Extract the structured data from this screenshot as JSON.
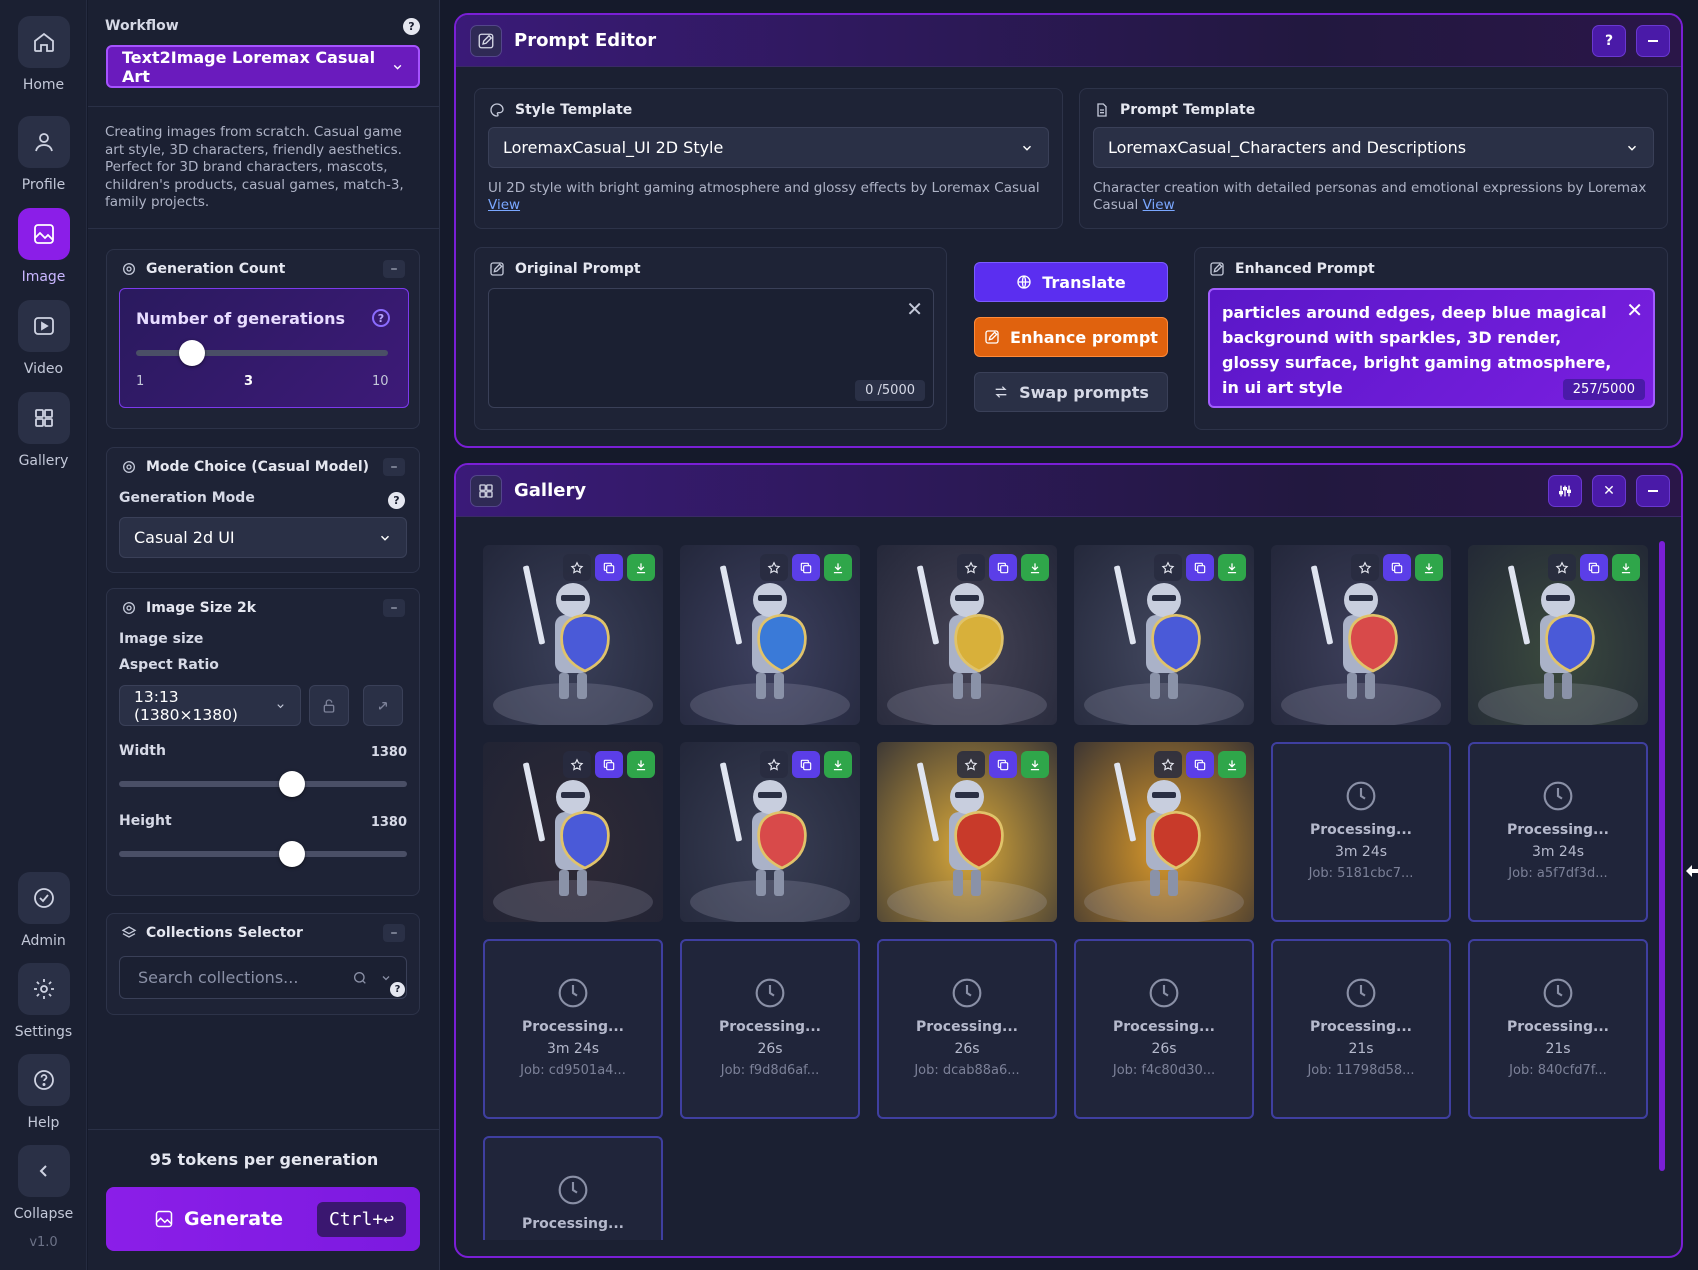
{
  "rail": {
    "items": [
      {
        "label": "Home",
        "icon": "home-icon"
      },
      {
        "label": "Profile",
        "icon": "user-icon"
      },
      {
        "label": "Image",
        "icon": "image-icon",
        "active": true
      },
      {
        "label": "Video",
        "icon": "video-icon"
      },
      {
        "label": "Gallery",
        "icon": "grid-icon"
      }
    ],
    "bottom": [
      {
        "label": "Admin",
        "icon": "shield-check-icon"
      },
      {
        "label": "Settings",
        "icon": "gear-icon"
      },
      {
        "label": "Help",
        "icon": "help-circle-icon"
      },
      {
        "label": "Collapse",
        "icon": "chevron-left-icon"
      }
    ],
    "version": "v1.0"
  },
  "panel": {
    "workflow_label": "Workflow",
    "workflow_value": "Text2Image Loremax Casual Art",
    "workflow_description": "Creating images from scratch. Casual game art style, 3D characters, friendly aesthetics. Perfect for 3D brand characters, mascots, children's products, casual games, match-3, family projects.",
    "generation_count": {
      "title": "Generation Count",
      "label": "Number of generations",
      "min": "1",
      "value": "3",
      "max": "10",
      "fraction": 0.222
    },
    "mode": {
      "title": "Mode Choice (Casual Model)",
      "label": "Generation Mode",
      "value": "Casual 2d UI"
    },
    "image_size": {
      "title": "Image Size 2k",
      "size_label": "Image size",
      "aspect_label": "Aspect Ratio",
      "aspect_value": "13:13 (1380×1380)",
      "width_label": "Width",
      "width_value": "1380",
      "width_fraction": 0.6,
      "height_label": "Height",
      "height_value": "1380",
      "height_fraction": 0.6
    },
    "collections": {
      "title": "Collections Selector",
      "placeholder": "Search collections..."
    },
    "tokens": "95 tokens per generation",
    "generate_label": "Generate",
    "shortcut": "Ctrl+↩"
  },
  "prompt_editor": {
    "title": "Prompt Editor",
    "help": "?",
    "style_template": {
      "title": "Style Template",
      "value": "LoremaxCasual_UI 2D Style",
      "description": "UI 2D style with bright gaming atmosphere and glossy effects by Loremax Casual",
      "link": "View"
    },
    "prompt_template": {
      "title": "Prompt Template",
      "value": "LoremaxCasual_Characters and Descriptions",
      "description": "Character creation with detailed personas and emotional expressions by Loremax Casual",
      "link": "View"
    },
    "original": {
      "title": "Original Prompt",
      "value": "",
      "counter": "0 /5000"
    },
    "buttons": {
      "translate": "Translate",
      "enhance": "Enhance prompt",
      "swap": "Swap prompts"
    },
    "enhanced": {
      "title": "Enhanced Prompt",
      "value": "particles around edges, deep blue magical background with sparkles, 3D render, glossy surface, bright gaming atmosphere, in ui art style",
      "counter": "257/5000"
    }
  },
  "gallery": {
    "title": "Gallery",
    "images": [
      {
        "name": "knight-1",
        "bg": "#3a3f58",
        "accent": "#4a5ad8"
      },
      {
        "name": "knight-2",
        "bg": "#3e4160",
        "accent": "#3a7ad8"
      },
      {
        "name": "knight-3",
        "bg": "#464456",
        "accent": "#d8b03a"
      },
      {
        "name": "knight-4",
        "bg": "#42475e",
        "accent": "#4a5ad8"
      },
      {
        "name": "knight-5",
        "bg": "#3d3f5a",
        "accent": "#d84a4a"
      },
      {
        "name": "knight-6",
        "bg": "#3b4a3e",
        "accent": "#4a5ad8"
      },
      {
        "name": "knight-7",
        "bg": "#2f2a36",
        "accent": "#4a5ad8"
      },
      {
        "name": "knight-8",
        "bg": "#3a3f55",
        "accent": "#d84a4a"
      },
      {
        "name": "knight-9",
        "bg": "#d8a83a",
        "accent": "#c83a2a"
      },
      {
        "name": "knight-10",
        "bg": "#d8982a",
        "accent": "#c83a2a"
      }
    ],
    "processing": [
      {
        "title": "Processing...",
        "time": "3m 24s",
        "job": "Job: 5181cbc7..."
      },
      {
        "title": "Processing...",
        "time": "3m 24s",
        "job": "Job: a5f7df3d..."
      },
      {
        "title": "Processing...",
        "time": "3m 24s",
        "job": "Job: cd9501a4..."
      },
      {
        "title": "Processing...",
        "time": "26s",
        "job": "Job: f9d8d6af..."
      },
      {
        "title": "Processing...",
        "time": "26s",
        "job": "Job: dcab88a6..."
      },
      {
        "title": "Processing...",
        "time": "26s",
        "job": "Job: f4c80d30..."
      },
      {
        "title": "Processing...",
        "time": "21s",
        "job": "Job: 11798d58..."
      },
      {
        "title": "Processing...",
        "time": "21s",
        "job": "Job: 840cfd7f..."
      },
      {
        "title": "Processing...",
        "time": "",
        "job": ""
      }
    ]
  }
}
